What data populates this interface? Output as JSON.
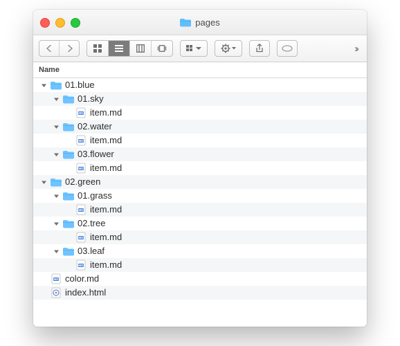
{
  "window": {
    "title": "pages"
  },
  "columns": [
    "Name"
  ],
  "indentUnit": 18,
  "baseIndent": 10,
  "rows": [
    {
      "depth": 0,
      "expanded": true,
      "kind": "folder",
      "name": "01.blue"
    },
    {
      "depth": 1,
      "expanded": true,
      "kind": "folder",
      "name": "01.sky"
    },
    {
      "depth": 2,
      "kind": "md",
      "name": "item.md"
    },
    {
      "depth": 1,
      "expanded": true,
      "kind": "folder",
      "name": "02.water"
    },
    {
      "depth": 2,
      "kind": "md",
      "name": "item.md"
    },
    {
      "depth": 1,
      "expanded": true,
      "kind": "folder",
      "name": "03.flower"
    },
    {
      "depth": 2,
      "kind": "md",
      "name": "item.md"
    },
    {
      "depth": 0,
      "expanded": true,
      "kind": "folder",
      "name": "02.green"
    },
    {
      "depth": 1,
      "expanded": true,
      "kind": "folder",
      "name": "01.grass"
    },
    {
      "depth": 2,
      "kind": "md",
      "name": "item.md"
    },
    {
      "depth": 1,
      "expanded": true,
      "kind": "folder",
      "name": "02.tree"
    },
    {
      "depth": 2,
      "kind": "md",
      "name": "item.md"
    },
    {
      "depth": 1,
      "expanded": true,
      "kind": "folder",
      "name": "03.leaf"
    },
    {
      "depth": 2,
      "kind": "md",
      "name": "item.md"
    },
    {
      "depth": 0,
      "kind": "md",
      "name": "color.md"
    },
    {
      "depth": 0,
      "kind": "html",
      "name": "index.html"
    }
  ],
  "iconNames": {
    "folder": "folder-icon",
    "md": "markdown-file-icon",
    "html": "html-file-icon"
  }
}
